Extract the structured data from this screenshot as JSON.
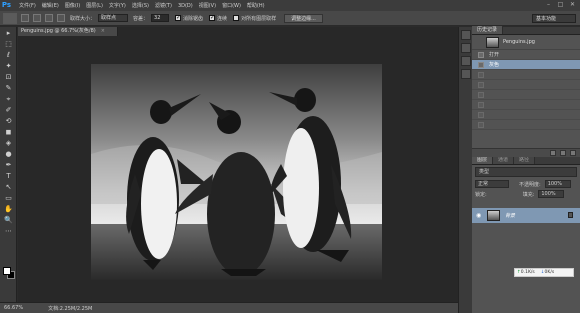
{
  "app": {
    "logo": "Ps"
  },
  "menu": [
    "文件(F)",
    "编辑(E)",
    "图像(I)",
    "图层(L)",
    "文字(Y)",
    "选择(S)",
    "滤镜(T)",
    "3D(D)",
    "视图(V)",
    "窗口(W)",
    "帮助(H)"
  ],
  "window_controls": [
    "–",
    "□",
    "✕"
  ],
  "options": {
    "sample_size_label": "取样大小：",
    "sample_size_value": "取样点",
    "tolerance_label": "容差：",
    "tolerance_value": "32",
    "antialias_label": "消除锯齿",
    "contiguous_label": "连续",
    "sample_all_label": "对所有图层取样",
    "refine_edge_button": "调整边缘...",
    "workspace": "基本功能"
  },
  "document": {
    "tab_title": "Penguins.jpg @ 66.7%(灰色/8)",
    "tab_close": "×",
    "zoom": "66.67%",
    "doc_info": "文档:2.25M/2.25M"
  },
  "tools": [
    "▸",
    "⬚",
    "ℓ",
    "✦",
    "⊡",
    "✎",
    "⌖",
    "✐",
    "⟲",
    "◼",
    "◈",
    "●",
    "✒",
    "T",
    "↖",
    "▭",
    "✋",
    "🔍",
    "⋯"
  ],
  "history": {
    "tab_label": "历史记录",
    "other_tab": "",
    "snapshot_name": "Penguins.jpg",
    "steps": [
      {
        "label": "打开",
        "state": "normal"
      },
      {
        "label": "灰色",
        "state": "active"
      },
      {
        "label": "",
        "state": "undone"
      },
      {
        "label": "",
        "state": "undone"
      },
      {
        "label": "",
        "state": "undone"
      },
      {
        "label": "",
        "state": "undone"
      },
      {
        "label": "",
        "state": "undone"
      },
      {
        "label": "",
        "state": "undone"
      },
      {
        "label": "",
        "state": "undone"
      }
    ]
  },
  "layers": {
    "tabs": [
      "图层",
      "通道",
      "路径"
    ],
    "filter_label": "类型",
    "blend_mode": "正常",
    "opacity_label": "不透明度:",
    "opacity_value": "100%",
    "lock_label": "锁定:",
    "fill_label": "填充:",
    "fill_value": "100%",
    "layer_name": "背景"
  },
  "netspeed": {
    "up_arrow": "↑",
    "up_value": "0.1K/s",
    "down_arrow": "↓",
    "down_value": "0K/s"
  }
}
